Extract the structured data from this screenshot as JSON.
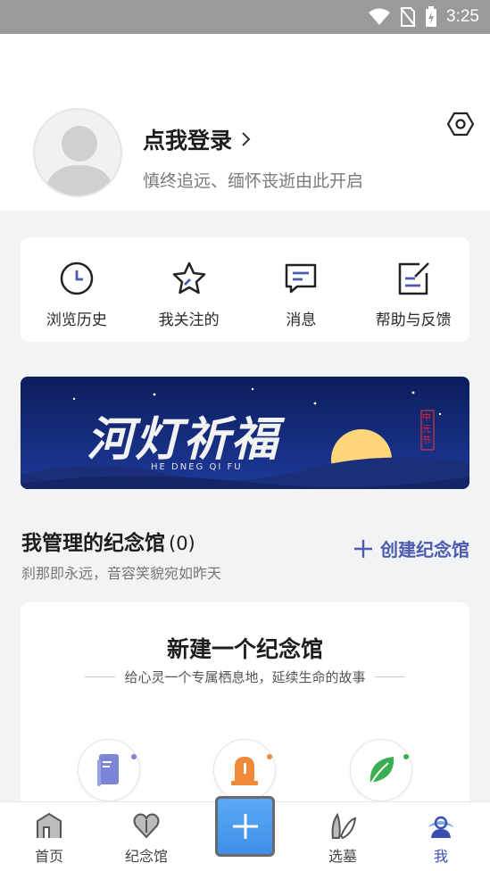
{
  "status_bar": {
    "time": "3:25"
  },
  "profile": {
    "title": "点我登录",
    "subtitle": "慎终追远、缅怀丧逝由此开启"
  },
  "quick_actions": [
    {
      "label": "浏览历史",
      "icon": "clock-icon"
    },
    {
      "label": "我关注的",
      "icon": "star-icon"
    },
    {
      "label": "消息",
      "icon": "message-icon"
    },
    {
      "label": "帮助与反馈",
      "icon": "feedback-icon"
    }
  ],
  "banner": {
    "title": "河灯祈福",
    "pinyin": "HE DNEG QI FU",
    "seal": "中元节",
    "colors": {
      "sky_top": "#0c1d5c",
      "sky_bottom": "#1d3a9a",
      "moon": "#ffd67a"
    }
  },
  "memorials": {
    "title": "我管理的纪念馆",
    "count": "(0)",
    "subtitle": "刹那即永远，音容笑貌宛如昨天",
    "create_label": "创建纪念馆"
  },
  "new_card": {
    "title": "新建一个纪念馆",
    "subtitle": "给心灵一个专属栖息地，延续生命的故事",
    "options": [
      {
        "icon": "phone-icon",
        "dot_color": "#7b84d6"
      },
      {
        "icon": "tombstone-icon",
        "dot_color": "#f08a3a"
      },
      {
        "icon": "leaf-icon",
        "dot_color": "#3cae52"
      }
    ]
  },
  "tabbar": {
    "items": [
      {
        "label": "首页",
        "icon": "home-icon"
      },
      {
        "label": "纪念馆",
        "icon": "memorial-heart-icon"
      },
      {
        "label": "选墓",
        "icon": "grave-select-icon"
      },
      {
        "label": "我",
        "icon": "profile-icon",
        "active": true
      }
    ],
    "accent": "#3b4db1"
  }
}
